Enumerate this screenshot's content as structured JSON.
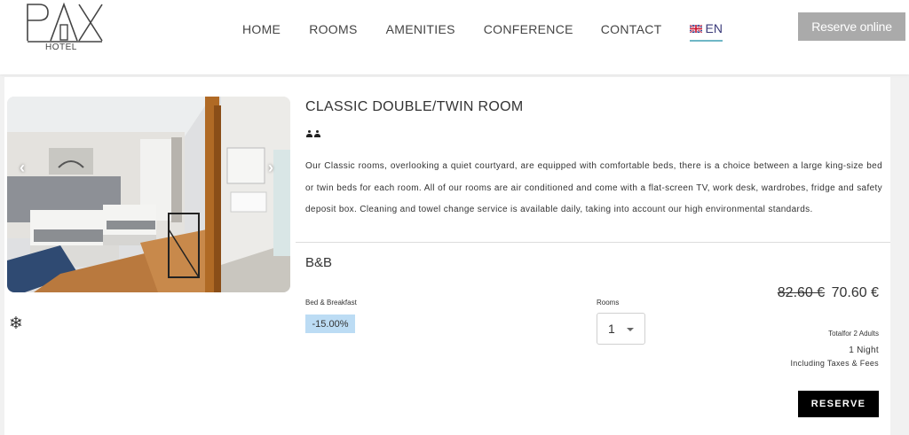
{
  "header": {
    "logo_text": "PAX",
    "logo_sub": "HOTEL",
    "nav": {
      "home": "HOME",
      "rooms": "ROOMS",
      "amenities": "AMENITIES",
      "conference": "CONFERENCE",
      "contact": "CONTACT"
    },
    "language": "EN",
    "reserve_online": "Reserve online"
  },
  "room": {
    "title": "CLASSIC DOUBLE/TWIN ROOM",
    "occupancy_icon": "two-persons-icon",
    "description": "Our Classic rooms, overlooking a quiet courtyard, are equipped with comfortable beds, there is a choice between a large king-size bed or twin beds for each room. All of our rooms are air conditioned and come with a flat-screen TV, work desk, wardrobes, fridge and safety deposit box. Cleaning and towel change service is available daily, taking into account our high environmental standards.",
    "gallery": {
      "prev_icon": "chevron-left-icon",
      "next_icon": "chevron-right-icon"
    },
    "amenity_icon": "snowflake-icon"
  },
  "rate": {
    "title": "B&B",
    "board_label": "Bed & Breakfast",
    "discount": "-15.00%",
    "rooms_label": "Rooms",
    "rooms_value": "1",
    "price_old": "82.60 €",
    "price_new": "70.60 €",
    "total_for": "Totalfor 2 Adults",
    "nights": "1 Night",
    "taxes": "Including Taxes & Fees",
    "reserve": "RESERVE"
  },
  "colors": {
    "accent_underline": "#6fb7c6",
    "discount_bg": "#bcdcf4",
    "reserve_online_bg": "#aaaaaa",
    "reserve_bg": "#000000"
  }
}
